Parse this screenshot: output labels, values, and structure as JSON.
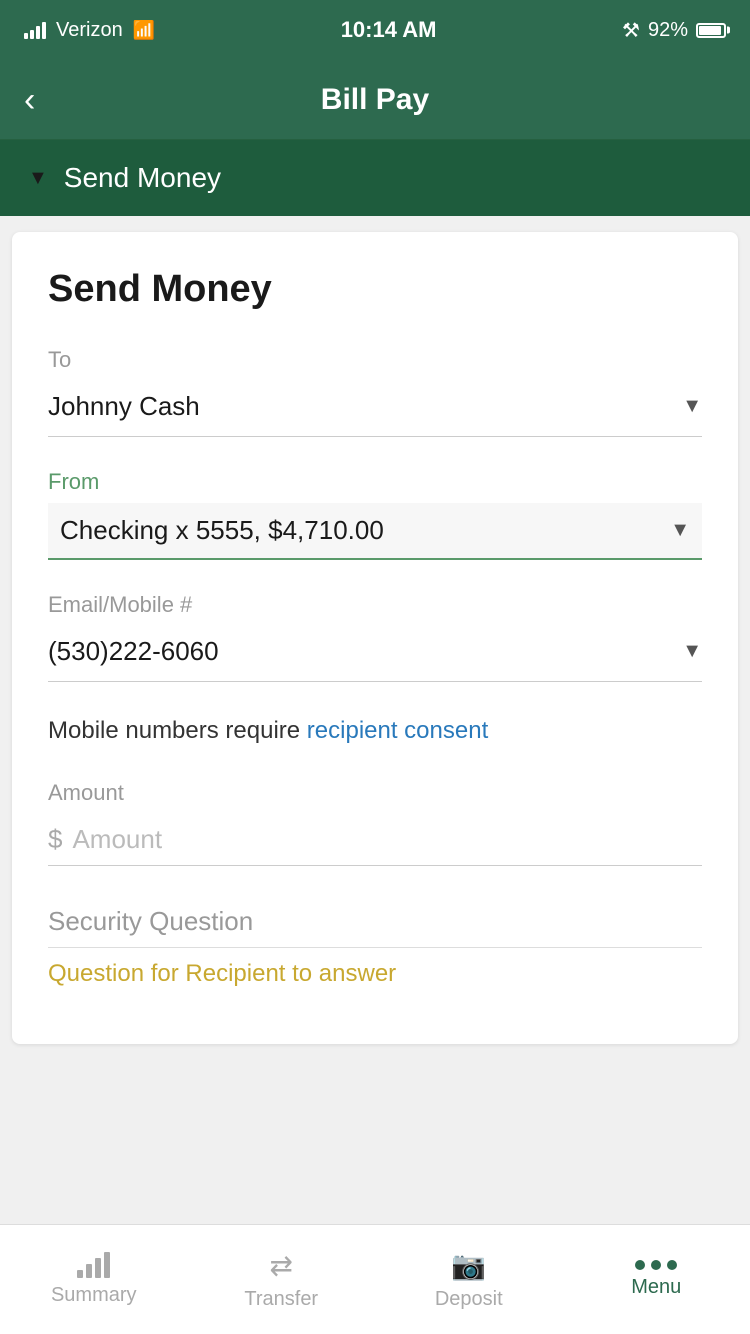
{
  "status_bar": {
    "carrier": "Verizon",
    "time": "10:14 AM",
    "battery_percent": "92%"
  },
  "nav": {
    "title": "Bill Pay",
    "back_label": "‹"
  },
  "dropdown_header": {
    "label": "Send Money"
  },
  "form": {
    "card_title": "Send Money",
    "to_label": "To",
    "to_value": "Johnny Cash",
    "from_label": "From",
    "from_value": "Checking x 5555, $4,710.00",
    "email_label": "Email/Mobile #",
    "email_value": "(530)222-6060",
    "mobile_note_prefix": "Mobile numbers require ",
    "mobile_note_link": "recipient consent",
    "amount_label": "Amount",
    "amount_placeholder": "Amount",
    "dollar_sign": "$",
    "security_label": "Security Question",
    "security_placeholder": "Question for Recipient to answer"
  },
  "bottom_nav": {
    "summary_label": "Summary",
    "transfer_label": "Transfer",
    "deposit_label": "Deposit",
    "menu_label": "Menu"
  }
}
